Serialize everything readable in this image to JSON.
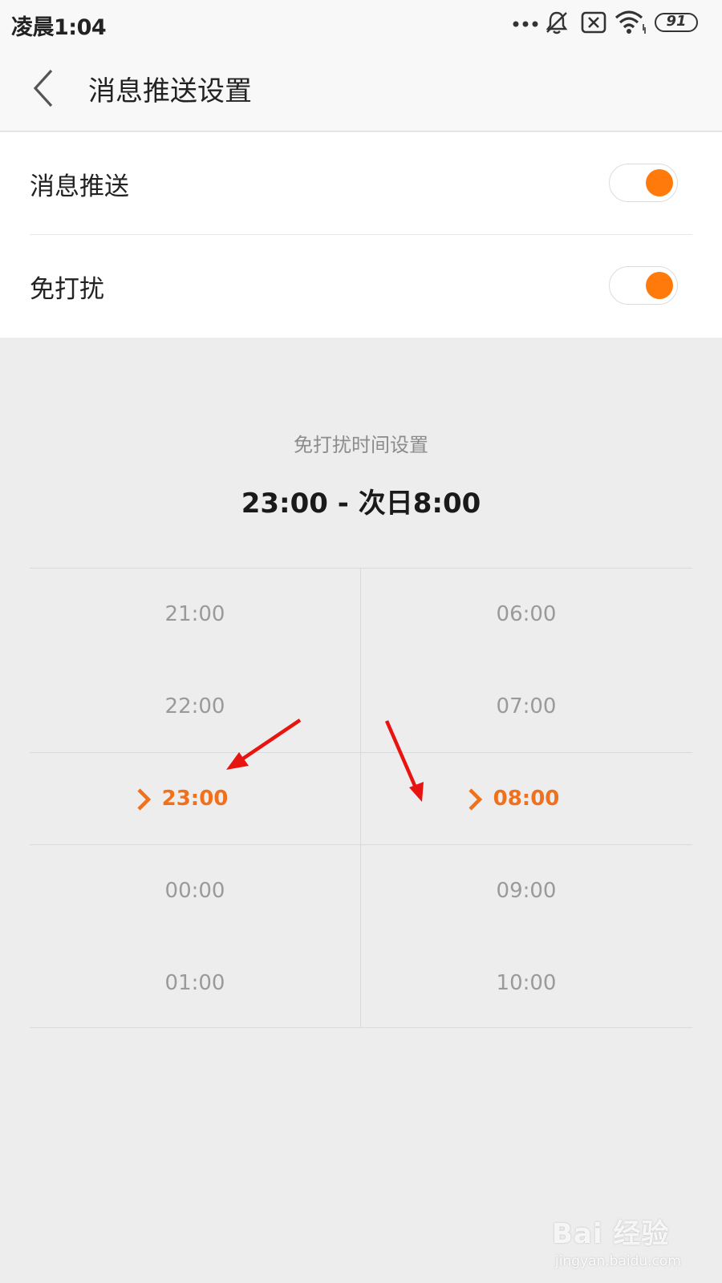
{
  "status_bar": {
    "time": "凌晨1:04",
    "battery": "91",
    "icons": [
      "more-dots-icon",
      "bell-off-icon",
      "sim-x-icon",
      "wifi-icon",
      "battery-icon"
    ]
  },
  "header": {
    "title": "消息推送设置",
    "back_icon": "chevron-left-icon"
  },
  "settings": [
    {
      "label": "消息推送",
      "enabled": true
    },
    {
      "label": "免打扰",
      "enabled": true
    }
  ],
  "dnd": {
    "subtitle": "免打扰时间设置",
    "range": "23:00 - 次日8:00"
  },
  "picker": {
    "start": {
      "options": [
        "21:00",
        "22:00",
        "23:00",
        "00:00",
        "01:00"
      ],
      "selected": "23:00"
    },
    "end": {
      "options": [
        "06:00",
        "07:00",
        "08:00",
        "09:00",
        "10:00"
      ],
      "selected": "08:00"
    }
  },
  "colors": {
    "accent": "#ff7a0a",
    "selected_text": "#f0701c",
    "annotation_arrow": "#e8140f",
    "background": "#ededed"
  },
  "watermark": {
    "logo_text": "Bai 经验",
    "url": "jingyan.baidu.com"
  }
}
